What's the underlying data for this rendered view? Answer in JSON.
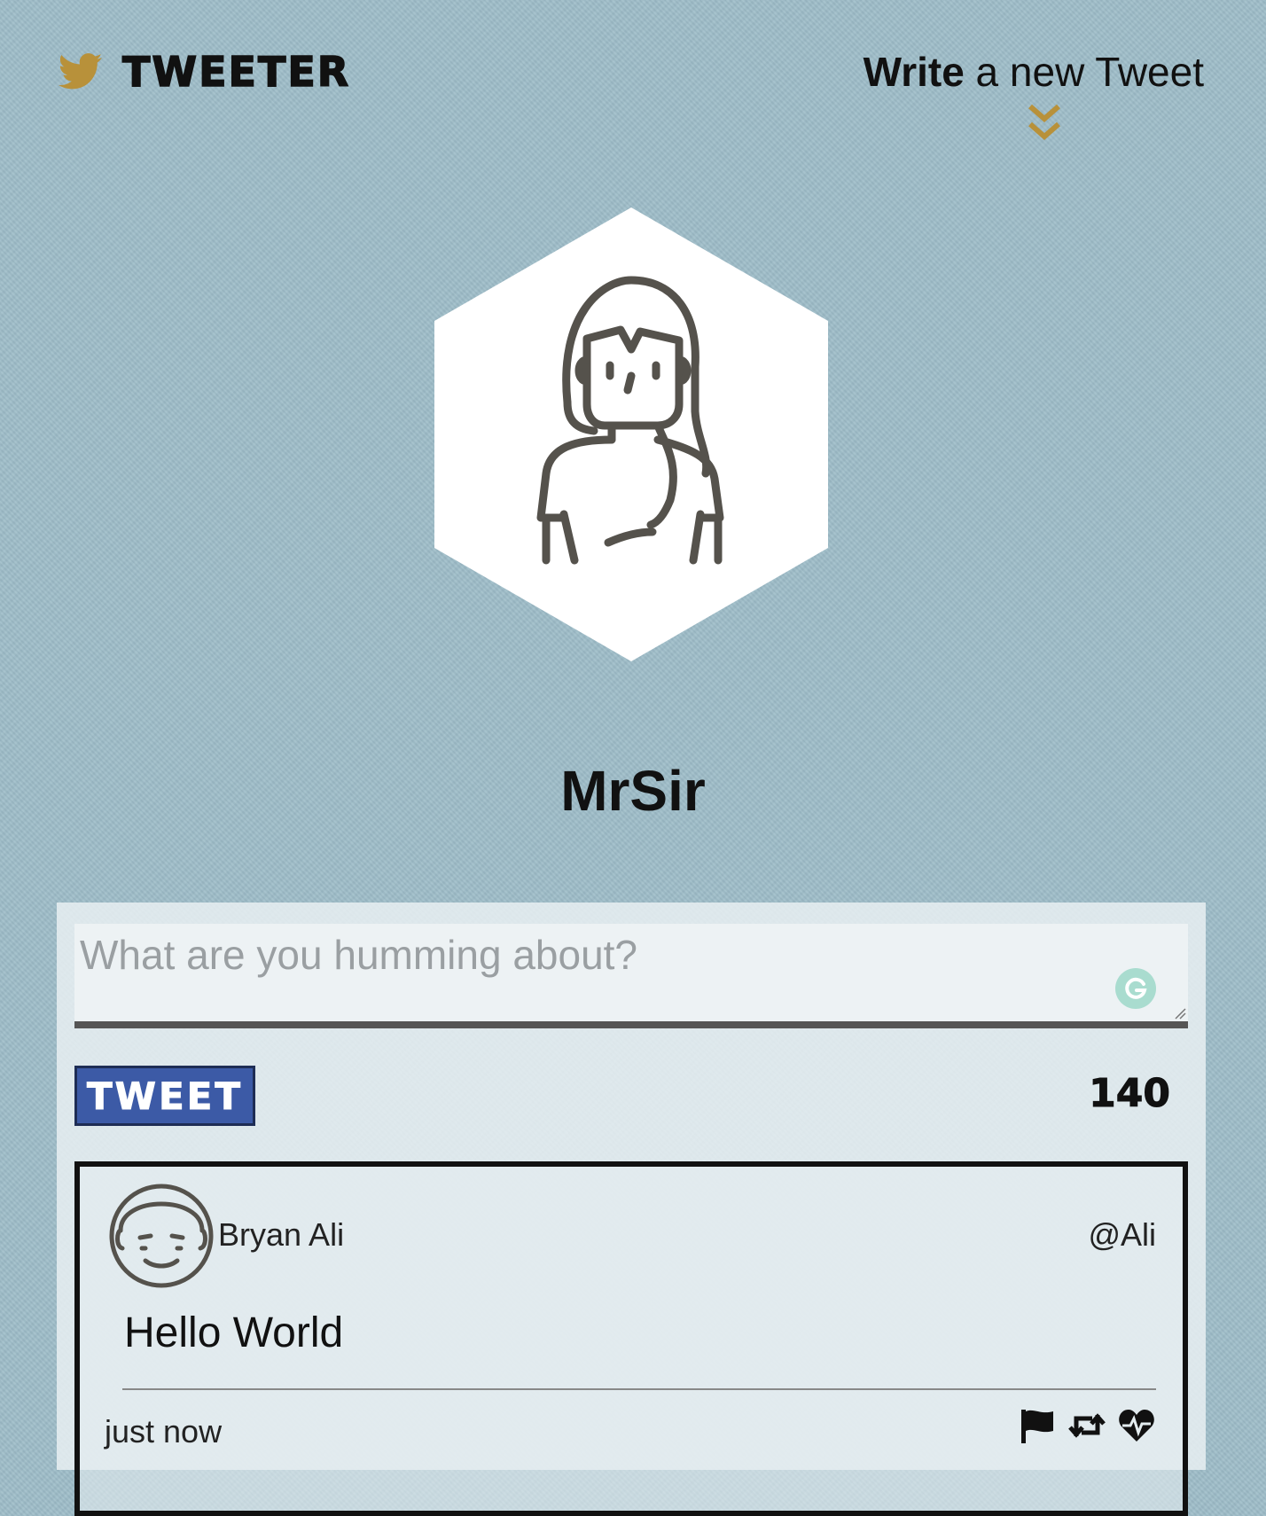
{
  "header": {
    "brand_name": "TWEETER",
    "brand_icon": "bird-icon",
    "compose_toggle_strong": "Write",
    "compose_toggle_rest": " a new Tweet",
    "compose_toggle_icon": "double-chevron-down-icon"
  },
  "profile": {
    "username": "MrSir",
    "avatar_icon": "woman-avatar-icon"
  },
  "composer": {
    "placeholder": "What are you humming about?",
    "value": "",
    "submit_label": "TWEET",
    "char_count": "140",
    "grammar_icon": "grammarly-icon"
  },
  "tweets": [
    {
      "author": "Bryan Ali",
      "handle": "@Ali",
      "body": "Hello World",
      "time": "just now",
      "avatar_icon": "man-avatar-icon",
      "actions": [
        "flag-icon",
        "retweet-icon",
        "heart-icon"
      ]
    }
  ],
  "colors": {
    "accent": "#b8913a",
    "background": "#9dbcc8",
    "button": "#3c5aa6",
    "grammarly": "#a9dccf"
  }
}
